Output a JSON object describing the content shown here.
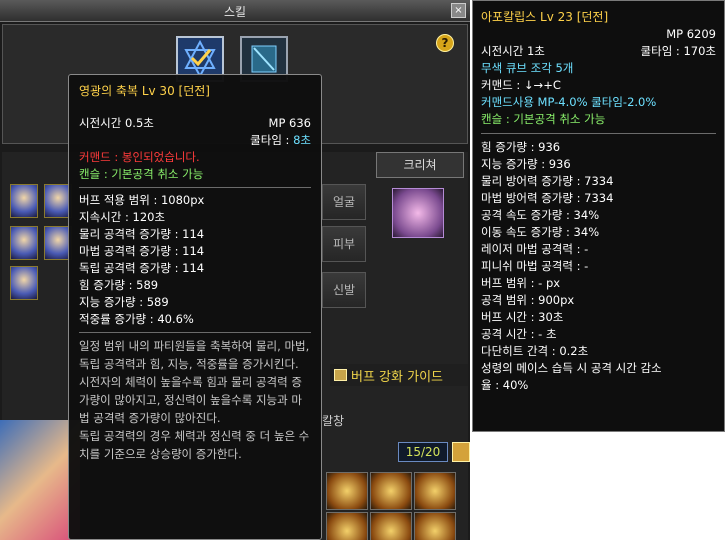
{
  "skill_window": {
    "title": "스킬",
    "close_label": "×",
    "help_label": "?",
    "tab_creature": "크리쳐",
    "equip_labels": [
      "얼굴",
      "피부",
      "신발"
    ],
    "buff_guide": "버프 강화 가이드",
    "counter": "15/20",
    "kalchang": "칼창"
  },
  "tooltip_primary": {
    "title": "영광의 축복 Lv 30 [던전]",
    "mp": "MP 636",
    "cast_time": "시전시간 0.5초",
    "cooldown_label": "쿨타임 : ",
    "cooldown_value": "8초",
    "command": "커맨드 : 봉인되었습니다.",
    "cancel": "캔슬 : 기본공격 취소 가능",
    "stats": [
      "버프 적용 범위 : 1080px",
      "지속시간 : 120초",
      "물리 공격력 증가량 : 114",
      "마법 공격력 증가량 : 114",
      "독립 공격력 증가량 : 114",
      "힘 증가량 : 589",
      "지능 증가량 : 589",
      "적중률 증가량 : 40.6%"
    ],
    "description": "일정 범위 내의 파티원들을 축복하여 물리, 마법, 독립 공격력과 힘, 지능, 적중률을 증가시킨다.\n시전자의 체력이 높을수록 힘과 물리 공격력 증가량이 많아지고, 정신력이 높을수록 지능과 마법 공격력 증가량이 많아진다.\n독립 공격력의 경우 체력과 정신력 중 더 높은 수치를 기준으로 상승량이 증가한다."
  },
  "tooltip_secondary": {
    "title": "아포칼립스 Lv 23 [던전]",
    "mp": "MP 6209",
    "cast_time": "시전시간 1초",
    "cooldown": "쿨타임 : 170초",
    "cube": "무색 큐브 조각 5개",
    "command": "커맨드 : ↓→+C",
    "command_use": "커맨드사용 MP-4.0% 쿨타임-2.0%",
    "cancel": "캔슬 : 기본공격 취소 가능",
    "stats": [
      "힘 증가량 : 936",
      "지능 증가량 : 936",
      "물리 방어력 증가량 : 7334",
      "마법 방어력 증가량 : 7334",
      "공격 속도 증가량 : 34%",
      "이동 속도 증가량 : 34%",
      "레이저 마법 공격력 : -",
      "피니쉬 마법 공격력 : -",
      "버프 범위 : - px",
      "공격 범위 : 900px",
      "버프 시간 : 30초",
      "공격 시간 : - 초",
      "다단히트 간격 : 0.2초",
      "성령의 메이스 습득 시 공격 시간 감소",
      "율 : 40%"
    ]
  }
}
